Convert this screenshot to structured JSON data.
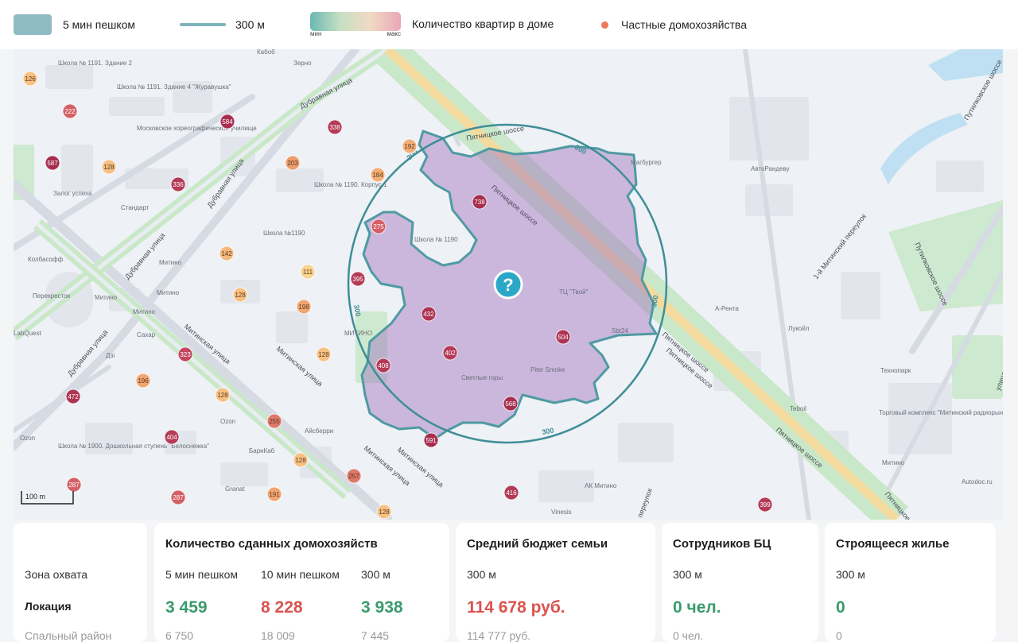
{
  "legend": {
    "walk5": "5 мин пешком",
    "radius": "300 м",
    "grad_min": "мин",
    "grad_max": "макс",
    "apartments": "Количество квартир в доме",
    "private": "Частные домохозяйства"
  },
  "map": {
    "scale": "100 m",
    "help_icon_glyph": "?",
    "ring_label": "300",
    "streets": {
      "s1": "Дубравная улица",
      "s2": "Дубравная улица",
      "s3": "Дубравная улица",
      "s4": "Дубравная улица",
      "s5": "Митинская улица",
      "s6": "Митинская улица",
      "s7": "Митинская улица",
      "s8": "Митинская улица",
      "s9": "Пятницкое шоссе",
      "s10": "Пятницкое шоссе",
      "s11": "Пятницкое шоссе",
      "s12": "Пятницкое шоссе",
      "s13": "1-й Митинский переулок",
      "s14": "Путилковское шоссе",
      "s15": "Путилковское шоссе",
      "s16": "Пятницкое шоссе",
      "s17": "переулок",
      "s18": "Пятницкое шоссе",
      "s19": "улица"
    },
    "pois": {
      "p1": "Кабоб",
      "p2": "Зерно",
      "p3": "Школа № 1191. Здание 2",
      "p4": "Школа № 1191. Здание 4 \"Журавушка\"",
      "p5": "Московское хореографическое училище",
      "p6": "Школа № 1190. Корпус 1",
      "p7": "Школа №1190",
      "p8": "Залог успеха",
      "p9": "Стандарт",
      "p10": "Колбасофф",
      "p11": "Перекресток",
      "p12": "Митино",
      "p13": "Митино",
      "p14": "Митино",
      "p15": "Сахар",
      "p16": "Дзі",
      "p17": "LabQuest",
      "p18": "Митино",
      "p19": "Ozon",
      "p20": "Школа № 1900. Дошкольная ступень \"Белоснежка\"",
      "p21": "Ozon",
      "p22": "Айсберри",
      "p23": "БарнКаб",
      "p24": "Granat",
      "p25": "Школа № 1190",
      "p26": "МИТИНО",
      "p27": "Светлые горы",
      "p28": "Piter Smoke",
      "p29": "ТЦ \"Твой\"",
      "p30": "Магбургер",
      "p31": "АвтоРандеву",
      "p32": "А-Рента",
      "p33": "Лукойл",
      "p34": "Технопарк",
      "p35": "Teboil",
      "p36": "Торговый комплекс \"Митинский радиорынок\"",
      "p37": "Митино",
      "p38": "АК Митино",
      "p39": "Vinesis",
      "p40": "Autodoc.ru",
      "p41": "Sbt24"
    },
    "badges": [
      {
        "v": "126",
        "t": 0.15
      },
      {
        "v": "222",
        "t": 0.6
      },
      {
        "v": "587",
        "t": 0.95
      },
      {
        "v": "128",
        "t": 0.15
      },
      {
        "v": "336",
        "t": 0.85
      },
      {
        "v": "584",
        "t": 0.95
      },
      {
        "v": "338",
        "t": 0.85
      },
      {
        "v": "203",
        "t": 0.35
      },
      {
        "v": "192",
        "t": 0.25
      },
      {
        "v": "192",
        "t": 0.25
      },
      {
        "v": "184",
        "t": 0.25
      },
      {
        "v": "738",
        "t": 0.95
      },
      {
        "v": "275",
        "t": 0.6
      },
      {
        "v": "142",
        "t": 0.2
      },
      {
        "v": "111",
        "t": 0.05
      },
      {
        "v": "395",
        "t": 0.85
      },
      {
        "v": "128",
        "t": 0.15
      },
      {
        "v": "198",
        "t": 0.3
      },
      {
        "v": "432",
        "t": 0.9
      },
      {
        "v": "323",
        "t": 0.75
      },
      {
        "v": "128",
        "t": 0.15
      },
      {
        "v": "408",
        "t": 0.85
      },
      {
        "v": "402",
        "t": 0.85
      },
      {
        "v": "504",
        "t": 0.9
      },
      {
        "v": "196",
        "t": 0.3
      },
      {
        "v": "472",
        "t": 0.9
      },
      {
        "v": "128",
        "t": 0.15
      },
      {
        "v": "255",
        "t": 0.5
      },
      {
        "v": "568",
        "t": 0.95
      },
      {
        "v": "404",
        "t": 0.85
      },
      {
        "v": "591",
        "t": 0.95
      },
      {
        "v": "128",
        "t": 0.15
      },
      {
        "v": "257",
        "t": 0.5
      },
      {
        "v": "287",
        "t": 0.6
      },
      {
        "v": "287",
        "t": 0.6
      },
      {
        "v": "191",
        "t": 0.3
      },
      {
        "v": "416",
        "t": 0.85
      },
      {
        "v": "128",
        "t": 0.15
      },
      {
        "v": "399",
        "t": 0.85
      }
    ]
  },
  "cards": {
    "coverage": "Зона охвата",
    "location": "Локация",
    "cut_side": "Спальный район",
    "households": {
      "title": "Количество сданных домохозяйств",
      "c1_label": "5 мин пешком",
      "c1_value": "3 459",
      "c1_faded": "6 750",
      "c2_label": "10 мин пешком",
      "c2_value": "8 228",
      "c2_faded": "18 009",
      "c3_label": "300 м",
      "c3_value": "3 938",
      "c3_faded": "7 445"
    },
    "budget": {
      "title": "Средний бюджет семьи",
      "label": "300 м",
      "value": "114 678 руб.",
      "faded": "114 777 руб."
    },
    "bc": {
      "title": "Сотрудников БЦ",
      "label": "300 м",
      "value": "0 чел.",
      "faded": "0 чел."
    },
    "construction": {
      "title": "Строящееся жилье",
      "label": "300 м",
      "value": "0",
      "faded": "0"
    }
  }
}
